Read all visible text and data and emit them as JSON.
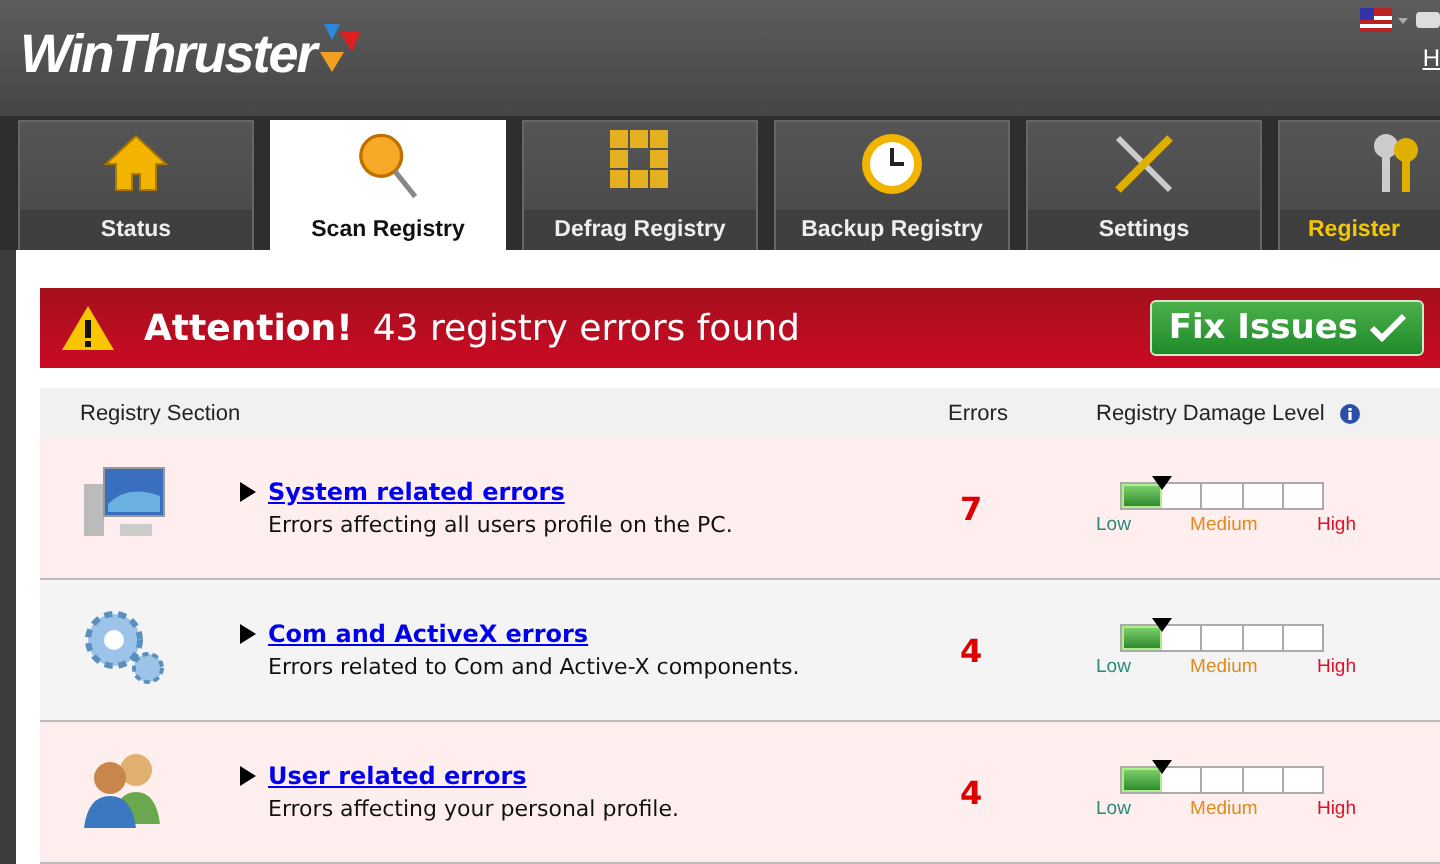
{
  "app": {
    "logo": "WinThruster",
    "help_link": "H"
  },
  "tabs": [
    {
      "label": "Status",
      "selected": false
    },
    {
      "label": "Scan Registry",
      "selected": true
    },
    {
      "label": "Defrag Registry",
      "selected": false
    },
    {
      "label": "Backup Registry",
      "selected": false
    },
    {
      "label": "Settings",
      "selected": false
    },
    {
      "label": "Register",
      "selected": false
    }
  ],
  "banner": {
    "title": "Attention!",
    "message": "43 registry errors found",
    "button": "Fix Issues"
  },
  "table": {
    "columns": [
      "Registry Section",
      "Errors",
      "Registry Damage Level"
    ],
    "rows": [
      {
        "title": "System related errors",
        "description": "Errors affecting all users profile on the PC.",
        "errors": "7",
        "level": 0.2,
        "scale": [
          "Low",
          "Medium",
          "High"
        ]
      },
      {
        "title": "Com and ActiveX errors",
        "description": "Errors related to Com and Active-X components.",
        "errors": "4",
        "level": 0.2,
        "scale": [
          "Low",
          "Medium",
          "High"
        ]
      },
      {
        "title": "User related errors",
        "description": "Errors affecting your personal profile.",
        "errors": "4",
        "level": 0.2,
        "scale": [
          "Low",
          "Medium",
          "High"
        ]
      }
    ]
  }
}
